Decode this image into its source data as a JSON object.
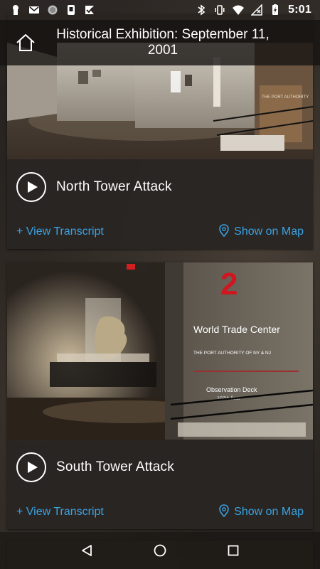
{
  "status_bar": {
    "time": "5:01",
    "left_icons": [
      "keyhole-icon",
      "gmail-icon",
      "sync-icon",
      "phone-icon",
      "check-flag-icon"
    ],
    "right_icons": [
      "bluetooth-icon",
      "vibrate-icon",
      "wifi-icon",
      "no-signal-icon",
      "battery-charging-icon"
    ]
  },
  "header": {
    "title": "Historical Exhibition: September 11, 2001",
    "home_icon": "home-icon"
  },
  "cards": [
    {
      "title": "North Tower Attack",
      "transcript_label": "+ View Transcript",
      "map_label": "Show on Map",
      "photo_texts": [
        "THE PORT AUTHORITY"
      ]
    },
    {
      "title": "South Tower Attack",
      "transcript_label": "+ View Transcript",
      "map_label": "Show on Map",
      "photo_texts": [
        "2",
        "World Trade Center",
        "THE PORT AUTHORITY OF NY & NJ",
        "Observation Deck",
        "107th floor"
      ]
    }
  ],
  "colors": {
    "accent": "#3aa3e3",
    "card_bg": "#282523",
    "header_bg": "#141211"
  },
  "nav_bar": {
    "icons": [
      "back-icon",
      "home-circle-icon",
      "recents-icon"
    ]
  }
}
